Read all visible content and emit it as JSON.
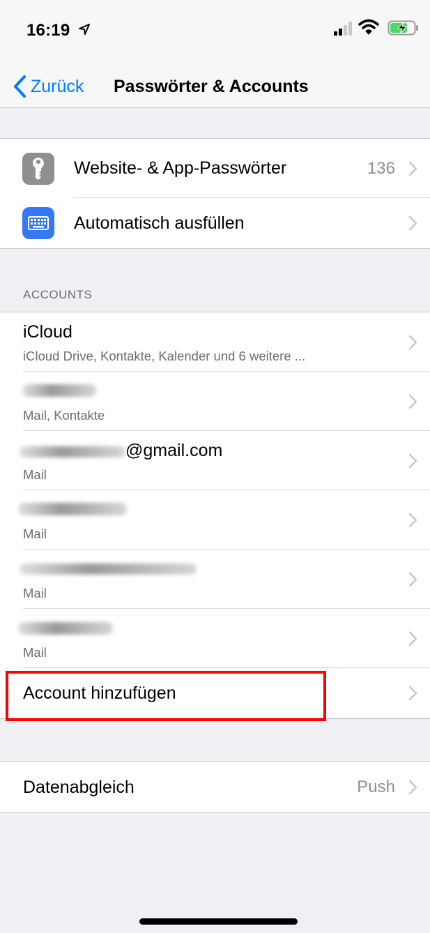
{
  "status_bar": {
    "time": "16:19"
  },
  "nav": {
    "back_label": "Zurück",
    "title": "Passwörter & Accounts"
  },
  "passwords_group": [
    {
      "label": "Website- & App-Passwörter",
      "value": "136",
      "icon": "key-icon",
      "icon_color": "#8e8e93"
    },
    {
      "label": "Automatisch ausfüllen",
      "value": "",
      "icon": "keyboard-icon",
      "icon_color": "#3478f6"
    }
  ],
  "accounts_section": {
    "header": "ACCOUNTS",
    "accounts": [
      {
        "title": "iCloud",
        "subtitle": "iCloud Drive, Kontakte, Kalender und 6 weitere ..."
      },
      {
        "title": "",
        "subtitle": "Mail, Kontakte"
      },
      {
        "title": "@gmail.com",
        "subtitle": "Mail"
      },
      {
        "title": "",
        "subtitle": "Mail"
      },
      {
        "title": "",
        "subtitle": "Mail"
      },
      {
        "title": "",
        "subtitle": "Mail"
      }
    ],
    "add_account_label": "Account hinzufügen"
  },
  "fetch_group": {
    "label": "Datenabgleich",
    "value": "Push"
  },
  "colors": {
    "accent": "#007aff",
    "highlight": "#ff0000"
  }
}
